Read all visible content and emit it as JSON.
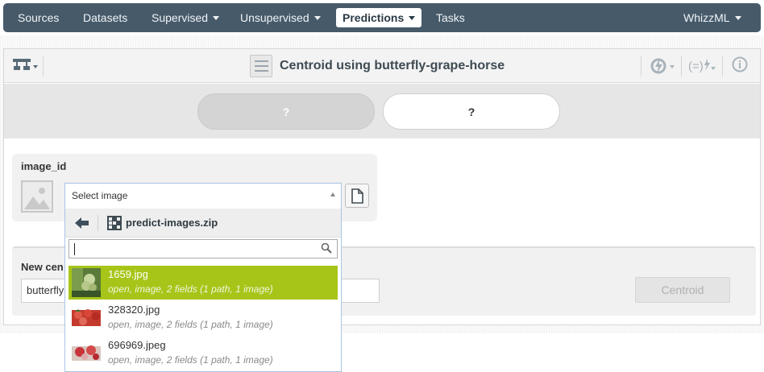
{
  "nav": {
    "items": [
      {
        "label": "Sources",
        "dropdown": false
      },
      {
        "label": "Datasets",
        "dropdown": false
      },
      {
        "label": "Supervised",
        "dropdown": true
      },
      {
        "label": "Unsupervised",
        "dropdown": true
      },
      {
        "label": "Predictions",
        "dropdown": true,
        "active": true
      },
      {
        "label": "Tasks",
        "dropdown": false
      }
    ],
    "user": "WhizzML"
  },
  "header": {
    "title": "Centroid using butterfly-grape-horse",
    "icons": [
      "model-tree-icon",
      "refresh-lightning-icon",
      "formula-lightning-icon",
      "info-icon"
    ]
  },
  "toggle": {
    "left_label": "?",
    "right_label": "?"
  },
  "field": {
    "label": "image_id",
    "select_value": "Select image"
  },
  "dropdown": {
    "folder": "predict-images.zip",
    "search_value": "",
    "items": [
      {
        "name": "1659.jpg",
        "meta": "open, image, 2 fields (1 path, 1 image)",
        "selected": true
      },
      {
        "name": "328320.jpg",
        "meta": "open, image, 2 fields (1 path, 1 image)",
        "selected": false
      },
      {
        "name": "696969.jpeg",
        "meta": "open, image, 2 fields (1 path, 1 image)",
        "selected": false
      }
    ]
  },
  "new_centroid": {
    "label": "New cen",
    "name_value": "butterfly",
    "button_label": "Centroid"
  },
  "colors": {
    "nav_bg": "#465a6a",
    "selected_item": "#a7c519",
    "disabled_button": "#e4e4e4"
  }
}
